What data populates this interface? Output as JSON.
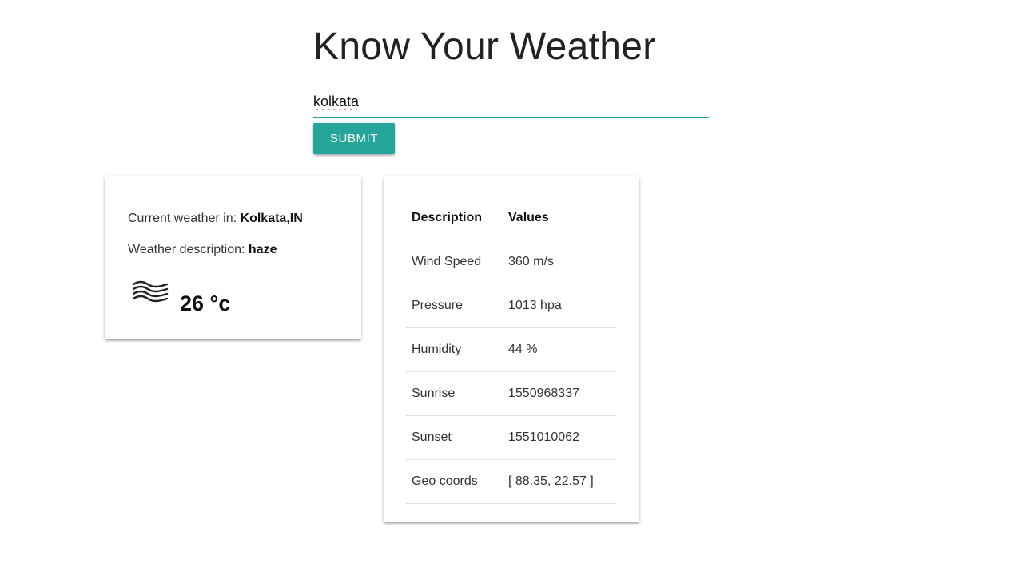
{
  "header": {
    "title": "Know Your Weather"
  },
  "search": {
    "value": "kolkata",
    "submit_label": "SUBMIT"
  },
  "current": {
    "location_label": "Current weather in: ",
    "location_value": "Kolkata,IN",
    "description_label": "Weather description: ",
    "description_value": "haze",
    "icon": "haze-icon",
    "temperature": "26 °c"
  },
  "details": {
    "headers": [
      "Description",
      "Values"
    ],
    "rows": [
      {
        "label": "Wind Speed",
        "value": "360 m/s"
      },
      {
        "label": "Pressure",
        "value": "1013 hpa"
      },
      {
        "label": "Humidity",
        "value": "44 %"
      },
      {
        "label": "Sunrise",
        "value": "1550968337"
      },
      {
        "label": "Sunset",
        "value": "1551010062"
      },
      {
        "label": "Geo coords",
        "value": "[ 88.35, 22.57 ]"
      }
    ]
  },
  "colors": {
    "accent": "#26a69a",
    "spellcheck": "#e53935"
  }
}
